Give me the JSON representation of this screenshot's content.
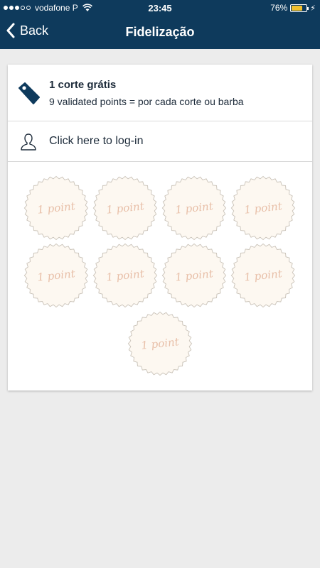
{
  "status_bar": {
    "carrier": "vodafone P",
    "time": "23:45",
    "battery_percent_text": "76%",
    "battery_level": 0.76,
    "signal_filled": 3,
    "signal_total": 5
  },
  "nav": {
    "back_label": "Back",
    "title": "Fidelização"
  },
  "reward": {
    "title": "1 corte grátis",
    "subtitle": "9 validated points = por cada corte ou barba",
    "icon": "tag-icon"
  },
  "login": {
    "label": "Click here to log-in",
    "icon": "user-icon"
  },
  "stamps": [
    {
      "label": "1 point"
    },
    {
      "label": "1 point"
    },
    {
      "label": "1 point"
    },
    {
      "label": "1 point"
    },
    {
      "label": "1 point"
    },
    {
      "label": "1 point"
    },
    {
      "label": "1 point"
    },
    {
      "label": "1 point"
    },
    {
      "label": "1 point"
    }
  ],
  "colors": {
    "header": "#0e3a5c",
    "background": "#ececec",
    "stamp_fill": "#fdf8f1",
    "stamp_text": "#e8bfa8",
    "battery": "#f2c12e"
  }
}
